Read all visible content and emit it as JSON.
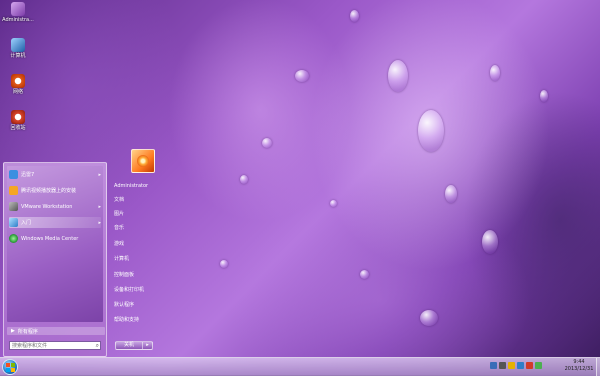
{
  "desktop": {
    "icons": [
      {
        "label": "Administra...",
        "icon": "user-folder-icon",
        "color": "#9b59c4"
      },
      {
        "label": "计算机",
        "icon": "computer-icon",
        "color": "#2f7ec9"
      },
      {
        "label": "网络",
        "icon": "network-icon",
        "color": "#e05a1a"
      },
      {
        "label": "回收站",
        "icon": "recycle-bin-icon",
        "color": "#d8452b"
      }
    ]
  },
  "start_menu": {
    "pinned": [
      {
        "label": "迅雷7",
        "icon": "thunder-icon",
        "color": "#3b8fe0",
        "has_submenu": true
      },
      {
        "label": "腾讯视频播放器上的安装",
        "icon": "tencent-video-icon",
        "color": "#f5a623",
        "has_submenu": false
      },
      {
        "label": "VMware Workstation",
        "icon": "vmware-icon",
        "color": "#6d6d6d",
        "has_submenu": true
      },
      {
        "label": "入门",
        "icon": "getting-started-icon",
        "color": "#3aa0e0",
        "has_submenu": true
      },
      {
        "label": "Windows Media Center",
        "icon": "media-center-icon",
        "color": "#2d9f3a",
        "has_submenu": false
      }
    ],
    "all_programs_label": "所有程序",
    "search_placeholder": "搜索程序和文件",
    "right_links": [
      "Administrator",
      "文档",
      "图片",
      "音乐",
      "游戏",
      "计算机",
      "控制面板",
      "设备和打印机",
      "默认程序",
      "帮助和支持"
    ],
    "shutdown_label": "关机"
  },
  "taskbar": {
    "time": "9:44",
    "date": "2013/12/31",
    "tray_icons": [
      "network-status-icon",
      "volume-icon",
      "action-center-icon",
      "language-icon",
      "ime-icon",
      "power-icon"
    ]
  },
  "colors": {
    "accent": "#9a5fc4",
    "wallpaper": "#b477de"
  }
}
